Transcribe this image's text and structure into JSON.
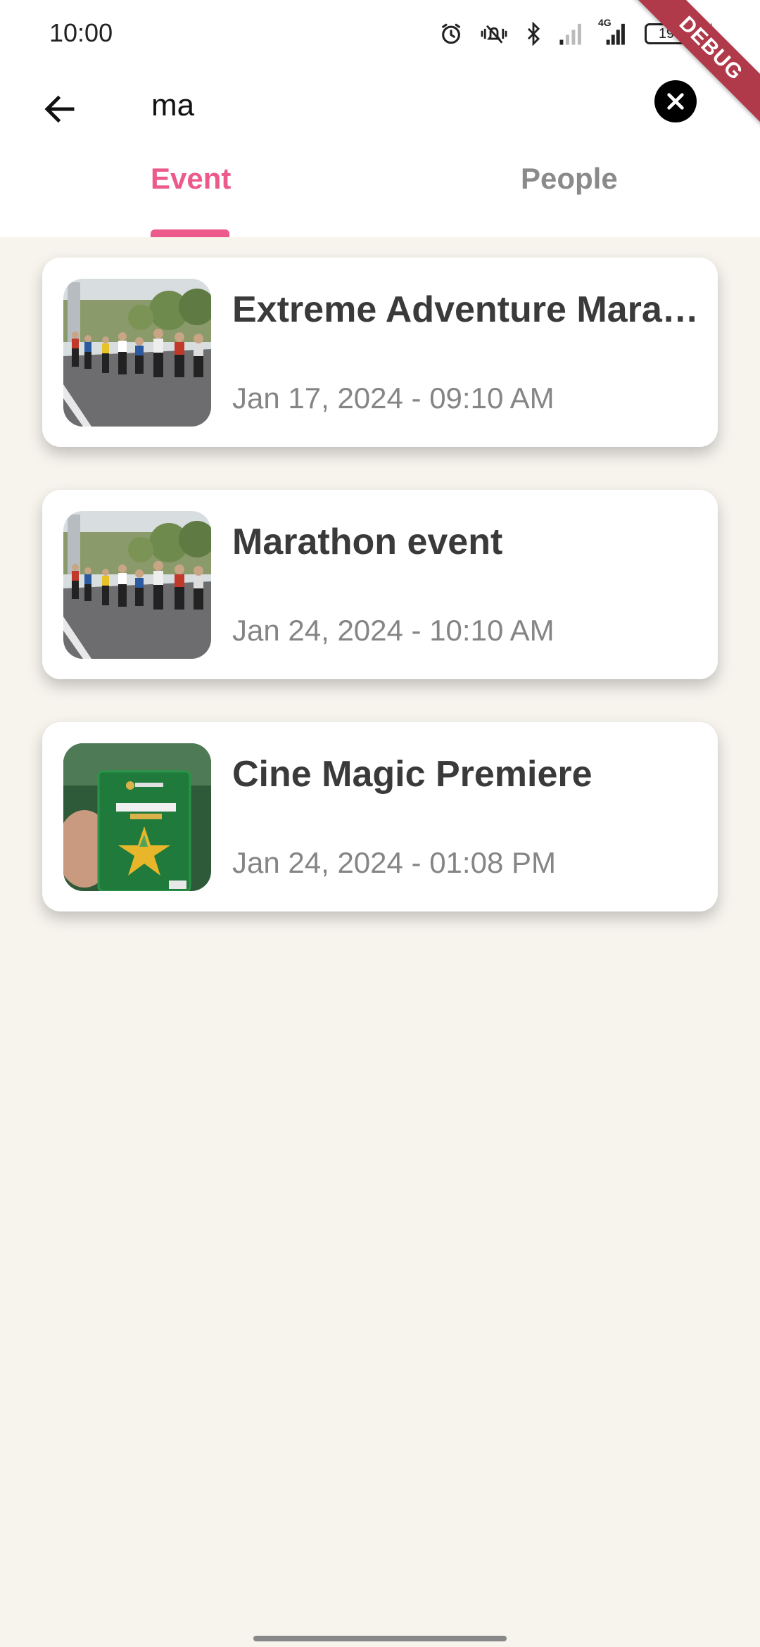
{
  "status_bar": {
    "time": "10:00",
    "battery": "19",
    "network": "4G",
    "icons": [
      "alarm-icon",
      "vibrate-mute-icon",
      "bluetooth-icon",
      "signal-weak-icon",
      "signal-4g-icon",
      "battery-icon",
      "charging-icon"
    ]
  },
  "debug_banner": "DEBUG",
  "search": {
    "query": "ma",
    "back_icon": "arrow-left-icon",
    "clear_icon": "close-circle-icon"
  },
  "tabs": [
    {
      "label": "Event",
      "active": true
    },
    {
      "label": "People",
      "active": false
    }
  ],
  "colors": {
    "accent": "#ec5a8b",
    "background": "#f7f4ee",
    "title": "#3a3a3a",
    "subtitle": "#858585"
  },
  "events": [
    {
      "title": "Extreme Adventure Marathon",
      "date": "Jan 17, 2024 - 09:10 AM",
      "image": "marathon-runners-photo"
    },
    {
      "title": "Marathon event",
      "date": "Jan 24, 2024 - 10:10 AM",
      "image": "marathon-runners-photo"
    },
    {
      "title": "Cine Magic Premiere",
      "date": "Jan 24, 2024 - 01:08 PM",
      "image": "green-voucher-card-photo"
    }
  ]
}
